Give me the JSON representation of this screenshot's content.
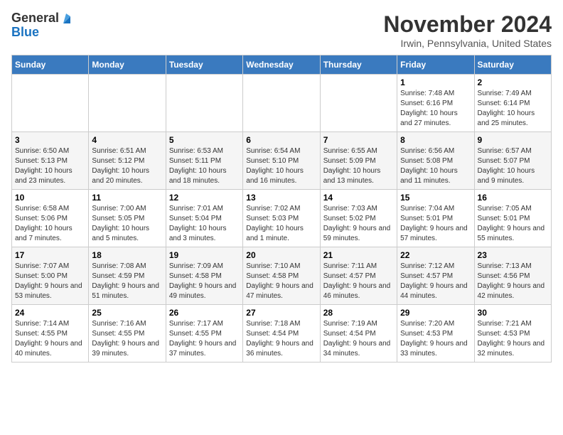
{
  "header": {
    "logo_line1": "General",
    "logo_line2": "Blue",
    "month": "November 2024",
    "location": "Irwin, Pennsylvania, United States"
  },
  "weekdays": [
    "Sunday",
    "Monday",
    "Tuesday",
    "Wednesday",
    "Thursday",
    "Friday",
    "Saturday"
  ],
  "weeks": [
    [
      {
        "day": "",
        "info": ""
      },
      {
        "day": "",
        "info": ""
      },
      {
        "day": "",
        "info": ""
      },
      {
        "day": "",
        "info": ""
      },
      {
        "day": "",
        "info": ""
      },
      {
        "day": "1",
        "info": "Sunrise: 7:48 AM\nSunset: 6:16 PM\nDaylight: 10 hours and 27 minutes."
      },
      {
        "day": "2",
        "info": "Sunrise: 7:49 AM\nSunset: 6:14 PM\nDaylight: 10 hours and 25 minutes."
      }
    ],
    [
      {
        "day": "3",
        "info": "Sunrise: 6:50 AM\nSunset: 5:13 PM\nDaylight: 10 hours and 23 minutes."
      },
      {
        "day": "4",
        "info": "Sunrise: 6:51 AM\nSunset: 5:12 PM\nDaylight: 10 hours and 20 minutes."
      },
      {
        "day": "5",
        "info": "Sunrise: 6:53 AM\nSunset: 5:11 PM\nDaylight: 10 hours and 18 minutes."
      },
      {
        "day": "6",
        "info": "Sunrise: 6:54 AM\nSunset: 5:10 PM\nDaylight: 10 hours and 16 minutes."
      },
      {
        "day": "7",
        "info": "Sunrise: 6:55 AM\nSunset: 5:09 PM\nDaylight: 10 hours and 13 minutes."
      },
      {
        "day": "8",
        "info": "Sunrise: 6:56 AM\nSunset: 5:08 PM\nDaylight: 10 hours and 11 minutes."
      },
      {
        "day": "9",
        "info": "Sunrise: 6:57 AM\nSunset: 5:07 PM\nDaylight: 10 hours and 9 minutes."
      }
    ],
    [
      {
        "day": "10",
        "info": "Sunrise: 6:58 AM\nSunset: 5:06 PM\nDaylight: 10 hours and 7 minutes."
      },
      {
        "day": "11",
        "info": "Sunrise: 7:00 AM\nSunset: 5:05 PM\nDaylight: 10 hours and 5 minutes."
      },
      {
        "day": "12",
        "info": "Sunrise: 7:01 AM\nSunset: 5:04 PM\nDaylight: 10 hours and 3 minutes."
      },
      {
        "day": "13",
        "info": "Sunrise: 7:02 AM\nSunset: 5:03 PM\nDaylight: 10 hours and 1 minute."
      },
      {
        "day": "14",
        "info": "Sunrise: 7:03 AM\nSunset: 5:02 PM\nDaylight: 9 hours and 59 minutes."
      },
      {
        "day": "15",
        "info": "Sunrise: 7:04 AM\nSunset: 5:01 PM\nDaylight: 9 hours and 57 minutes."
      },
      {
        "day": "16",
        "info": "Sunrise: 7:05 AM\nSunset: 5:01 PM\nDaylight: 9 hours and 55 minutes."
      }
    ],
    [
      {
        "day": "17",
        "info": "Sunrise: 7:07 AM\nSunset: 5:00 PM\nDaylight: 9 hours and 53 minutes."
      },
      {
        "day": "18",
        "info": "Sunrise: 7:08 AM\nSunset: 4:59 PM\nDaylight: 9 hours and 51 minutes."
      },
      {
        "day": "19",
        "info": "Sunrise: 7:09 AM\nSunset: 4:58 PM\nDaylight: 9 hours and 49 minutes."
      },
      {
        "day": "20",
        "info": "Sunrise: 7:10 AM\nSunset: 4:58 PM\nDaylight: 9 hours and 47 minutes."
      },
      {
        "day": "21",
        "info": "Sunrise: 7:11 AM\nSunset: 4:57 PM\nDaylight: 9 hours and 46 minutes."
      },
      {
        "day": "22",
        "info": "Sunrise: 7:12 AM\nSunset: 4:57 PM\nDaylight: 9 hours and 44 minutes."
      },
      {
        "day": "23",
        "info": "Sunrise: 7:13 AM\nSunset: 4:56 PM\nDaylight: 9 hours and 42 minutes."
      }
    ],
    [
      {
        "day": "24",
        "info": "Sunrise: 7:14 AM\nSunset: 4:55 PM\nDaylight: 9 hours and 40 minutes."
      },
      {
        "day": "25",
        "info": "Sunrise: 7:16 AM\nSunset: 4:55 PM\nDaylight: 9 hours and 39 minutes."
      },
      {
        "day": "26",
        "info": "Sunrise: 7:17 AM\nSunset: 4:55 PM\nDaylight: 9 hours and 37 minutes."
      },
      {
        "day": "27",
        "info": "Sunrise: 7:18 AM\nSunset: 4:54 PM\nDaylight: 9 hours and 36 minutes."
      },
      {
        "day": "28",
        "info": "Sunrise: 7:19 AM\nSunset: 4:54 PM\nDaylight: 9 hours and 34 minutes."
      },
      {
        "day": "29",
        "info": "Sunrise: 7:20 AM\nSunset: 4:53 PM\nDaylight: 9 hours and 33 minutes."
      },
      {
        "day": "30",
        "info": "Sunrise: 7:21 AM\nSunset: 4:53 PM\nDaylight: 9 hours and 32 minutes."
      }
    ]
  ]
}
